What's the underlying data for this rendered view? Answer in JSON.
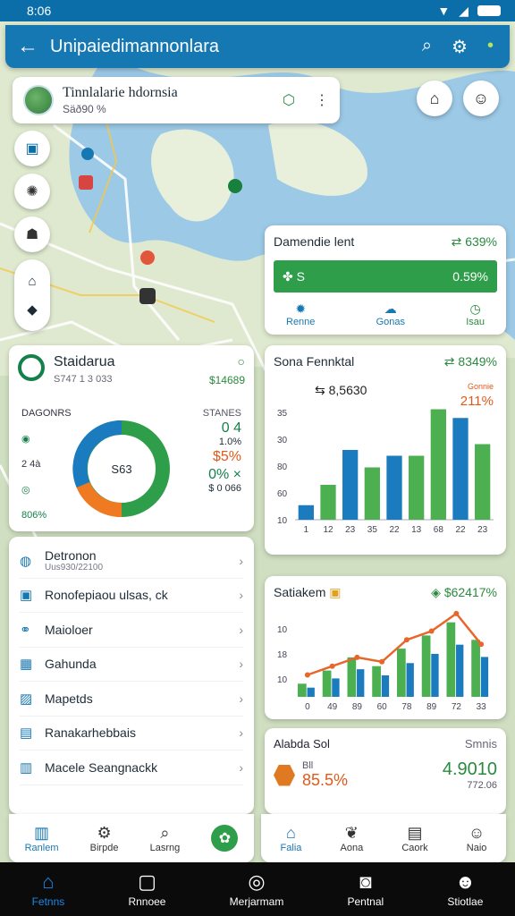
{
  "status": {
    "time": "8:06"
  },
  "appbar": {
    "title": "Unipaiedimannonlara",
    "back_icon": "arrow-left-icon",
    "actions": [
      "search-icon",
      "gear-icon",
      "location-pin-icon"
    ]
  },
  "location": {
    "title": "Tinnlalarie hdornsia",
    "subtitle": "Säð90 %"
  },
  "demand": {
    "title": "Damendie lent",
    "change": "639%",
    "bar_label": "S",
    "bar_value": "0.59%",
    "tabs": [
      {
        "label": "Renne"
      },
      {
        "label": "Gonas"
      },
      {
        "label": "Isau"
      }
    ]
  },
  "stats": {
    "title": "Staidarua",
    "subtitle": "S747 1 3 033",
    "value": "$14689",
    "left_heading": "DAGONRS",
    "left_items": [
      "2 4à",
      "806%"
    ],
    "right_heading": "STANES",
    "right_items": [
      "0 4",
      "1.0%",
      "$5%",
      "0% ×",
      "$ 0 066"
    ],
    "center": "S63",
    "colors": {
      "blue": "#1a7bbf",
      "green": "#2f9e4a",
      "orange": "#f07a22"
    }
  },
  "barcard": {
    "title": "Sona Fennktal",
    "change": "8349%",
    "price": "8,5630",
    "orange_label": "Gonnie",
    "orange_value": "211%"
  },
  "chart_data": [
    {
      "type": "bar",
      "title": "Sona Fennktal",
      "categories": [
        "1",
        "12",
        "23",
        "35",
        "22",
        "13",
        "68",
        "22",
        "23"
      ],
      "series": [
        {
          "color": "#1a7bbf",
          "values": [
            5,
            0,
            24,
            0,
            22,
            0,
            0,
            35,
            0
          ]
        },
        {
          "color": "#4caf50",
          "values": [
            0,
            12,
            0,
            18,
            0,
            22,
            38,
            0,
            26
          ]
        }
      ],
      "yticks": [
        "35",
        "30",
        "80",
        "60",
        "10"
      ],
      "ylim": [
        0,
        40
      ]
    },
    {
      "type": "line",
      "title": "Satiakem",
      "categories": [
        "0",
        "49",
        "89",
        "60",
        "78",
        "89",
        "72",
        "33"
      ],
      "bars": [
        6,
        12,
        18,
        14,
        22,
        28,
        34,
        26
      ],
      "line": [
        10,
        14,
        18,
        16,
        26,
        30,
        38,
        24
      ],
      "yticks": [
        "10",
        "18",
        "10"
      ]
    }
  ],
  "linecard": {
    "title": "Satiakem",
    "change": "$62417%"
  },
  "kpi": {
    "title": "Alabda Sol",
    "right_title": "Smnis",
    "label": "Bll",
    "pct": "85.5%",
    "value": "4.9010",
    "sub": "772.06"
  },
  "menu": [
    {
      "label": "Detronon",
      "sub": "Uus930/22100",
      "icon": "globe-icon"
    },
    {
      "label": "Ronofepiaou ulsas, ck",
      "icon": "camera-icon"
    },
    {
      "label": "Maioloer",
      "icon": "handshake-icon"
    },
    {
      "label": "Gahunda",
      "icon": "calendar-icon"
    },
    {
      "label": "Mapetds",
      "icon": "map-icon"
    },
    {
      "label": "Ranakarhebbais",
      "icon": "document-icon"
    },
    {
      "label": "Macele Seangnackk",
      "icon": "clipboard-icon"
    }
  ],
  "leftnav": [
    {
      "label": "Ranlem"
    },
    {
      "label": "Birpde"
    },
    {
      "label": "Lasrng"
    }
  ],
  "rightnav": [
    {
      "label": "Falia"
    },
    {
      "label": "Aona"
    },
    {
      "label": "Caork"
    },
    {
      "label": "Naio"
    }
  ],
  "sysnav": [
    {
      "label": "Fetnns"
    },
    {
      "label": "Rnnoee"
    },
    {
      "label": "Merjarmam"
    },
    {
      "label": "Pentnal"
    },
    {
      "label": "Stiotlae"
    }
  ]
}
